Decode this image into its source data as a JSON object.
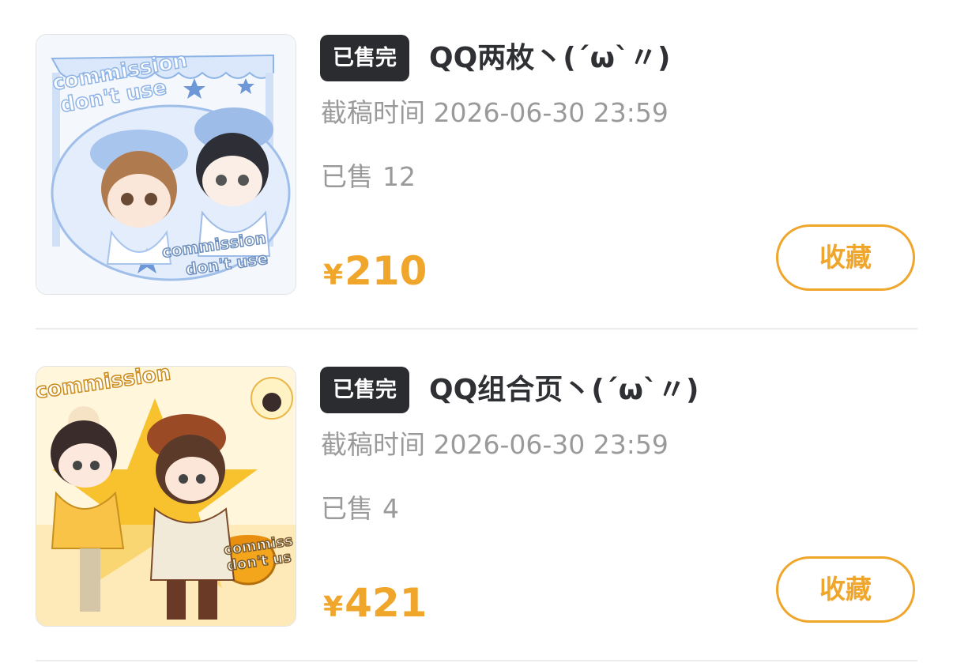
{
  "items": [
    {
      "badge": "已售完",
      "title": "QQ两枚丶(´ω`〃)",
      "deadline": "截稿时间 2026-06-30 23:59",
      "sold_label": "已售",
      "sold_count": "12",
      "currency": "¥",
      "price": "210",
      "favorite_label": "收藏",
      "image_text": [
        "commission",
        "don't use",
        "commission",
        "don't use"
      ]
    },
    {
      "badge": "已售完",
      "title": "QQ组合页丶(´ω`〃)",
      "deadline": "截稿时间 2026-06-30 23:59",
      "sold_label": "已售",
      "sold_count": "4",
      "currency": "¥",
      "price": "421",
      "favorite_label": "收藏",
      "image_text": [
        "commission",
        "commiss",
        "don't us"
      ]
    }
  ],
  "colors": {
    "accent": "#f0a52b",
    "badge_bg": "#2b2c2f",
    "title": "#2f3033",
    "muted": "#9a9a9a",
    "divider": "#ececec"
  }
}
